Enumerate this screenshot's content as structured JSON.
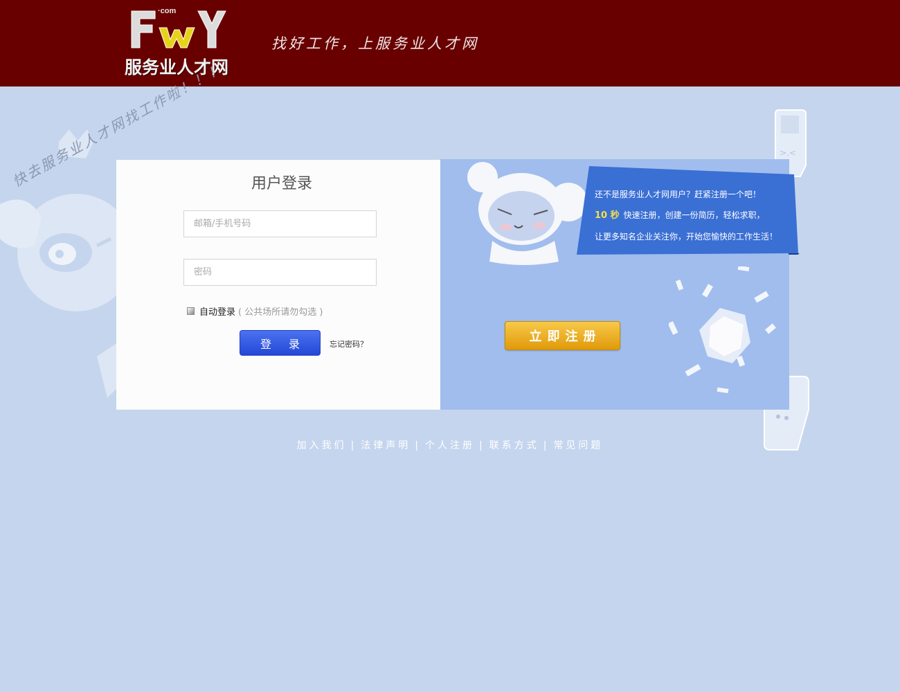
{
  "header": {
    "logo_text": "服务业人才网",
    "logo_com": "·com",
    "slogan": "找好工作，上服务业人才网"
  },
  "background": {
    "tagline": "快去服务业人才网找工作啦！！！"
  },
  "login": {
    "title": "用户登录",
    "email_placeholder": "邮箱/手机号码",
    "password_placeholder": "密码",
    "remember_label": "自动登录",
    "remember_hint": "( 公共场所请勿勾选 )",
    "login_button": "登 录",
    "forgot_link": "忘记密码？"
  },
  "promo": {
    "line1": "还不是服务业人才网用户？赶紧注册一个吧！",
    "highlight": "10 秒",
    "line2": "快速注册，创建一份简历，轻松求职，",
    "line3": "让更多知名企业关注你，开始您愉快的工作生活！",
    "register_button": "立即注册"
  },
  "footer": {
    "links": [
      "加入我们",
      "法律声明",
      "个人注册",
      "联系方式",
      "常见问题"
    ],
    "separator": "|"
  },
  "colors": {
    "header_bg": "#690000",
    "page_bg": "#c5d5ed",
    "promo_bg": "#a0bded",
    "ribbon": "#3a6fd4",
    "login_button": "#2448d6",
    "register_button": "#e09a0a",
    "highlight": "#f0e24a"
  }
}
